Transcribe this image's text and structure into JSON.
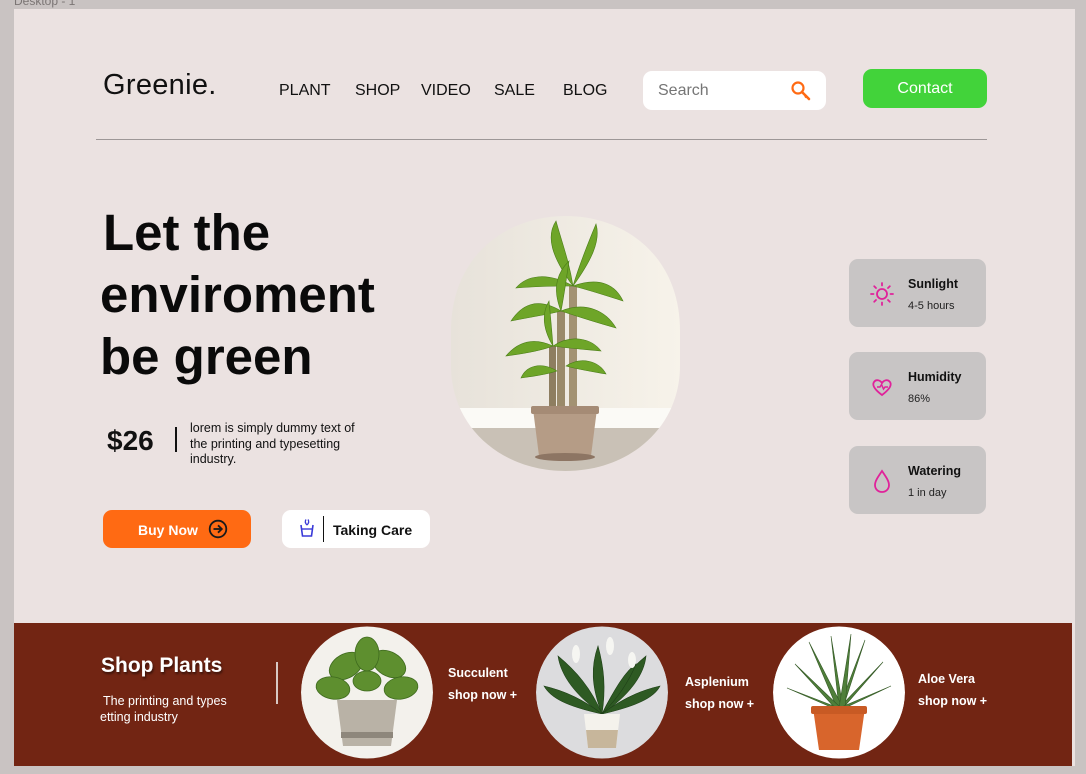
{
  "frame": {
    "label": "Desktop - 1"
  },
  "header": {
    "logo": "Greenie.",
    "nav": [
      "PLANT",
      "SHOP",
      "VIDEO",
      "SALE",
      "BLOG"
    ],
    "search_placeholder": "Search",
    "contact_label": "Contact"
  },
  "hero": {
    "title_lines": [
      "Let the",
      "enviroment",
      "be green"
    ],
    "price": "$26",
    "description": "lorem is simply dummy text of the printing and typesetting industry.",
    "buy_label": "Buy Now",
    "care_label": "Taking Care"
  },
  "stats": [
    {
      "title": "Sunlight",
      "value": "4-5 hours",
      "icon": "sun-icon"
    },
    {
      "title": "Humidity",
      "value": "86%",
      "icon": "humidity-icon"
    },
    {
      "title": "Watering",
      "value": "1 in day",
      "icon": "water-drop-icon"
    }
  ],
  "shop": {
    "title": "Shop Plants",
    "subtitle": "The printing and types etting industry",
    "items": [
      {
        "name": "Succulent",
        "link": "shop now +"
      },
      {
        "name": "Asplenium",
        "link": "shop now +"
      },
      {
        "name": "Aloe Vera",
        "link": "shop now +"
      }
    ]
  },
  "colors": {
    "accent_green": "#42d33a",
    "accent_orange": "#ff6a13",
    "band_brown": "#722513",
    "background": "#ebe2e1",
    "stat_card": "#c8c5c5",
    "icon_pink": "#e0229a"
  }
}
